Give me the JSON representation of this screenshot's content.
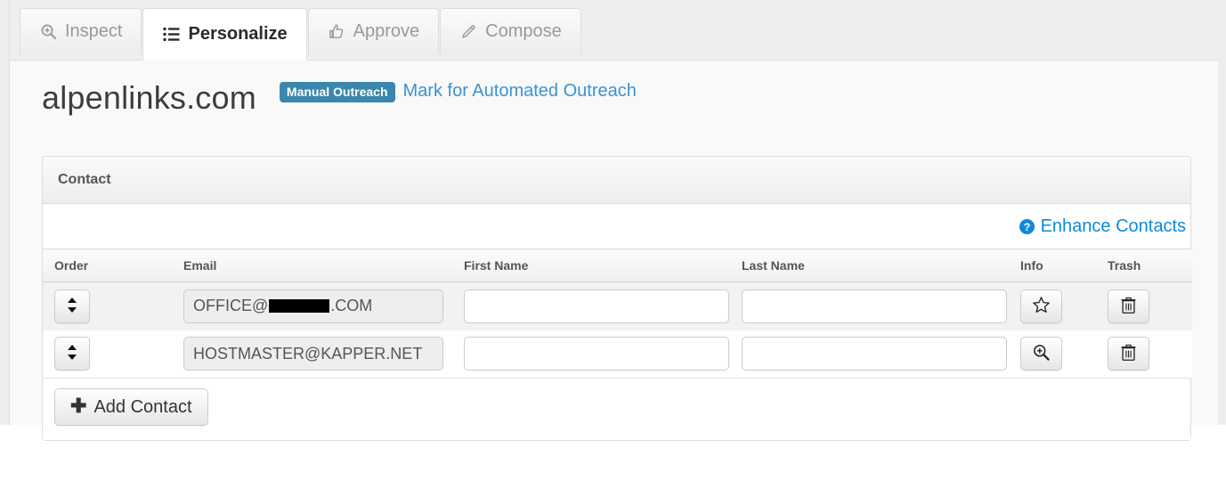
{
  "tabs": [
    {
      "label": "Inspect",
      "icon": "search-plus-icon",
      "active": false
    },
    {
      "label": "Personalize",
      "icon": "list-icon",
      "active": true
    },
    {
      "label": "Approve",
      "icon": "thumbs-up-icon",
      "active": false
    },
    {
      "label": "Compose",
      "icon": "pencil-icon",
      "active": false
    }
  ],
  "header": {
    "domain": "alpenlinks.com",
    "badge": "Manual Outreach",
    "badge_color": "#3a87ad",
    "automated_link": "Mark for Automated Outreach",
    "link_color": "#3b92d4"
  },
  "panel": {
    "title": "Contact",
    "enhance_link": "Enhance Contacts",
    "enhance_icon": "question-circle-icon",
    "enhance_color": "#0f8ada"
  },
  "table": {
    "columns": [
      "Order",
      "Email",
      "First Name",
      "Last Name",
      "Info",
      "Trash"
    ],
    "rows": [
      {
        "sort_icon": "sort-updown-icon",
        "email_prefix": "OFFICE@",
        "email_redacted": true,
        "email_suffix": ".COM",
        "first_name": "",
        "last_name": "",
        "first_name_placeholder": "",
        "last_name_placeholder": "",
        "info_icon": "star-icon",
        "trash_icon": "trash-icon"
      },
      {
        "sort_icon": "sort-updown-icon",
        "email_prefix": "HOSTMASTER@KAPPER.NET",
        "email_redacted": false,
        "email_suffix": "",
        "first_name": "",
        "last_name": "",
        "first_name_placeholder": "",
        "last_name_placeholder": "",
        "info_icon": "search-plus-icon",
        "trash_icon": "trash-icon"
      }
    ]
  },
  "actions": {
    "add_contact": "Add Contact",
    "add_contact_icon": "plus-icon"
  }
}
